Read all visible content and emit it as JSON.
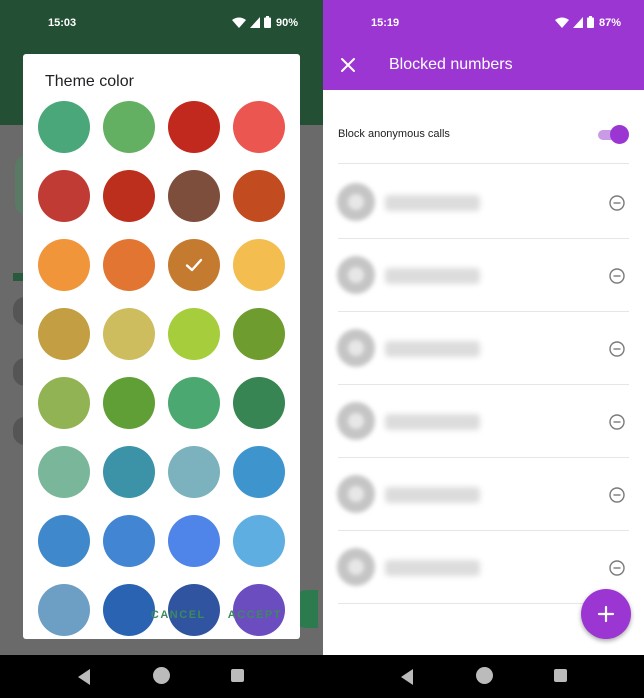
{
  "left_screen": {
    "status": {
      "time": "15:03",
      "battery": "90%"
    },
    "dialog": {
      "title": "Theme color",
      "cancel_label": "CANCEL",
      "accept_label": "ACCEPT",
      "selected_index": 10,
      "swatches": [
        "#4aa77a",
        "#64b062",
        "#c2291e",
        "#eb5650",
        "#c13b35",
        "#bb2f1c",
        "#7e4e3d",
        "#c24c1f",
        "#f0953a",
        "#e27531",
        "#c57b2f",
        "#f4bd4f",
        "#c39e42",
        "#cdbd5f",
        "#a6cd3c",
        "#6e9c2f",
        "#92b354",
        "#5f9f35",
        "#4aa870",
        "#368552",
        "#79b69a",
        "#3c93a7",
        "#7bb2bd",
        "#3e94cd",
        "#3e88cb",
        "#4285d3",
        "#4f84e9",
        "#5eaee1",
        "#6d9ec4",
        "#2a63b1",
        "#3154a0",
        "#6b4dbf"
      ]
    }
  },
  "right_screen": {
    "status": {
      "time": "15:19",
      "battery": "87%"
    },
    "title": "Blocked numbers",
    "anonymous_label": "Block anonymous calls",
    "anonymous_enabled": true,
    "blocked_rows": [
      1,
      2,
      3,
      4,
      5,
      6
    ],
    "accent": "#9b36d3"
  }
}
